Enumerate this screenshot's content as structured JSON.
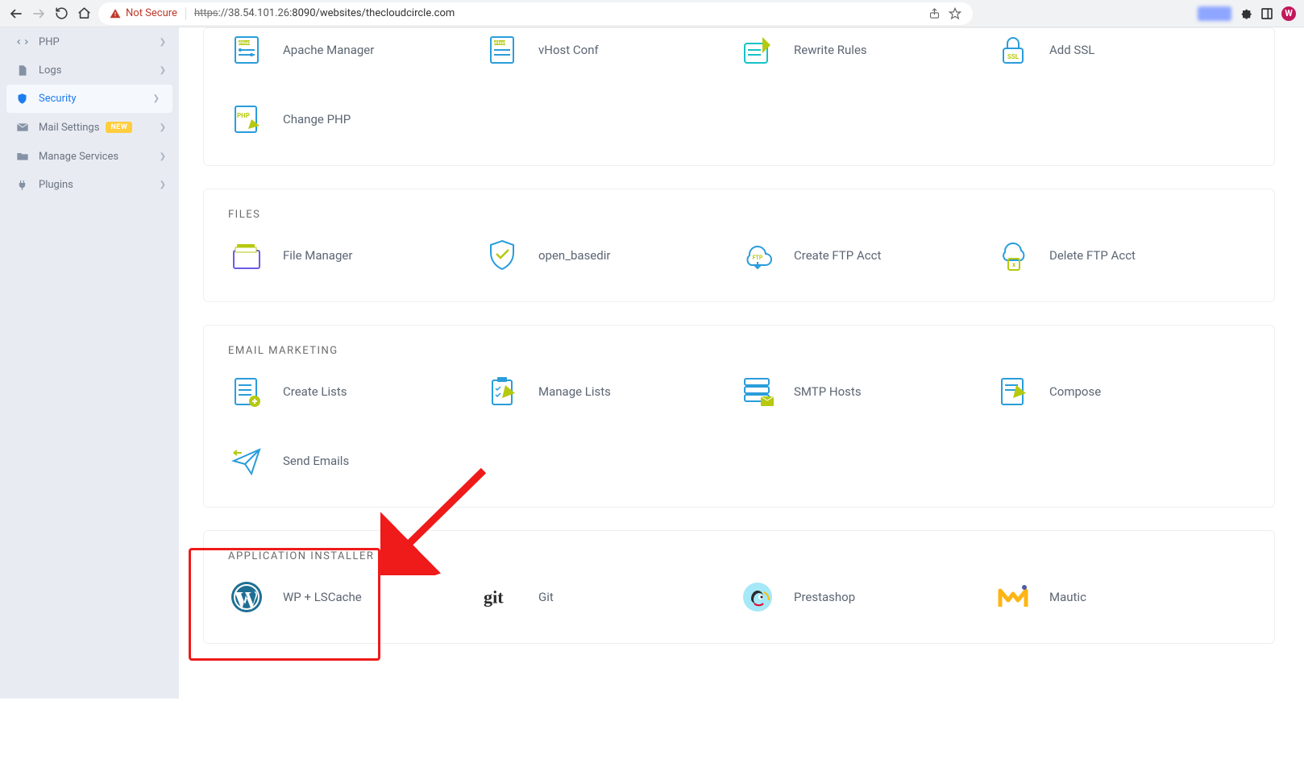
{
  "browser": {
    "not_secure": "Not Secure",
    "url_proto": "https",
    "url_host": "://38.54.101.26",
    "url_port": ":8090",
    "url_path": "/websites/thecloudcircle.com",
    "avatar_letter": "W"
  },
  "sidebar": {
    "items": [
      {
        "label": "PHP"
      },
      {
        "label": "Logs"
      },
      {
        "label": "Security"
      },
      {
        "label": "Mail Settings",
        "badge": "NEW"
      },
      {
        "label": "Manage Services"
      },
      {
        "label": "Plugins"
      }
    ]
  },
  "panels": {
    "config": {
      "tiles": [
        {
          "label": "Apache Manager"
        },
        {
          "label": "vHost Conf"
        },
        {
          "label": "Rewrite Rules"
        },
        {
          "label": "Add SSL"
        },
        {
          "label": "Change PHP"
        }
      ]
    },
    "files": {
      "title": "FILES",
      "tiles": [
        {
          "label": "File Manager"
        },
        {
          "label": "open_basedir"
        },
        {
          "label": "Create FTP Acct"
        },
        {
          "label": "Delete FTP Acct"
        }
      ]
    },
    "email": {
      "title": "EMAIL MARKETING",
      "tiles": [
        {
          "label": "Create Lists"
        },
        {
          "label": "Manage Lists"
        },
        {
          "label": "SMTP Hosts"
        },
        {
          "label": "Compose"
        },
        {
          "label": "Send Emails"
        }
      ]
    },
    "installer": {
      "title": "APPLICATION INSTALLER",
      "tiles": [
        {
          "label": "WP + LSCache"
        },
        {
          "label": "Git"
        },
        {
          "label": "Prestashop"
        },
        {
          "label": "Mautic"
        }
      ]
    }
  }
}
